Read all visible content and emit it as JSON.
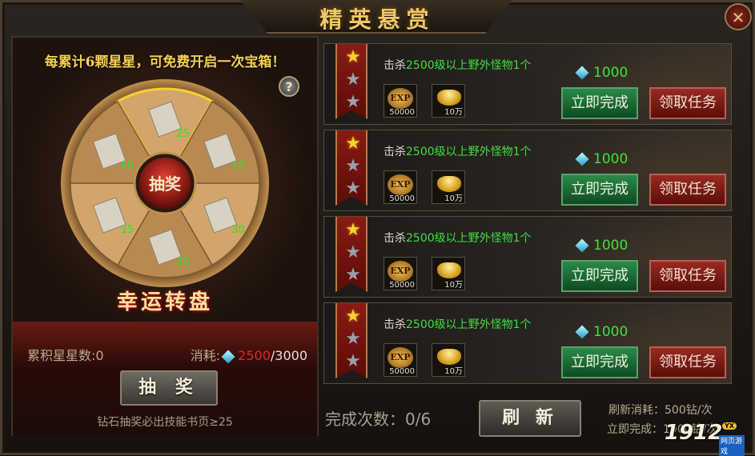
{
  "window": {
    "title": "精英悬赏",
    "close_icon": "close-icon"
  },
  "lottery": {
    "hint": "每累计6颗星星，可免费开启一次宝箱！",
    "help": "?",
    "wheel_title": "幸运转盘",
    "center_label": "抽奖",
    "segments": [
      "25",
      "10",
      "30",
      "20",
      "15",
      "40"
    ],
    "stars_label": "累积星星数:0",
    "cost_label": "消耗:",
    "cost_current": "2500",
    "cost_total": "/3000",
    "draw_button": "抽 奖",
    "note": "钻石抽奖必出技能书页≥25"
  },
  "quests": [
    {
      "stars": [
        true,
        false,
        false
      ],
      "text_prefix": "击杀",
      "text_green": "2500级以上野外怪物1个",
      "exp_label": "EXP",
      "exp_value": "50000",
      "gold_value": "10万",
      "diamonds": "1000",
      "complete_button": "立即完成",
      "accept_button": "领取任务"
    },
    {
      "stars": [
        true,
        false,
        false
      ],
      "text_prefix": "击杀",
      "text_green": "2500级以上野外怪物1个",
      "exp_label": "EXP",
      "exp_value": "50000",
      "gold_value": "10万",
      "diamonds": "1000",
      "complete_button": "立即完成",
      "accept_button": "领取任务"
    },
    {
      "stars": [
        true,
        false,
        false
      ],
      "text_prefix": "击杀",
      "text_green": "2500级以上野外怪物1个",
      "exp_label": "EXP",
      "exp_value": "50000",
      "gold_value": "10万",
      "diamonds": "1000",
      "complete_button": "立即完成",
      "accept_button": "领取任务"
    },
    {
      "stars": [
        true,
        false,
        false
      ],
      "text_prefix": "击杀",
      "text_green": "2500级以上野外怪物1个",
      "exp_label": "EXP",
      "exp_value": "50000",
      "gold_value": "10万",
      "diamonds": "1000",
      "complete_button": "立即完成",
      "accept_button": "领取任务"
    }
  ],
  "footer": {
    "complete_count": "完成次数：0/6",
    "refresh_button": "刷 新",
    "refresh_cost": "刷新消耗：500钻/次",
    "instant_cost": "立即完成：1000钻/次"
  },
  "logo": {
    "number": "1912",
    "badge": "YX",
    "sub": "网页游戏"
  }
}
